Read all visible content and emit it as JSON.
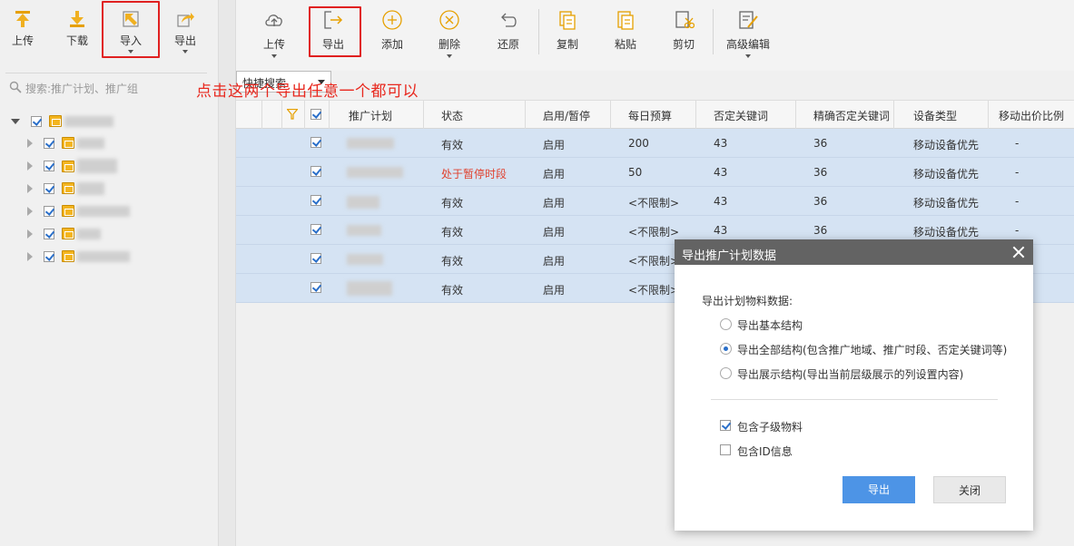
{
  "left_toolbar": {
    "items": [
      {
        "label": "上传",
        "icon": "upload-arrow-icon"
      },
      {
        "label": "下载",
        "icon": "download-arrow-icon"
      },
      {
        "label": "导入",
        "icon": "import-icon"
      },
      {
        "label": "导出",
        "icon": "export-icon"
      }
    ]
  },
  "left_search": {
    "placeholder": "搜索:推广计划、推广组"
  },
  "main_toolbar": {
    "items": [
      {
        "label": "上传",
        "icon": "cloud-upload-icon",
        "dropdown": true
      },
      {
        "label": "导出",
        "icon": "export-arrow-icon",
        "dropdown": false
      },
      {
        "label": "添加",
        "icon": "add-circle-icon",
        "dropdown": false
      },
      {
        "label": "删除",
        "icon": "delete-circle-icon",
        "dropdown": true
      },
      {
        "label": "还原",
        "icon": "undo-icon",
        "dropdown": false
      },
      {
        "label": "复制",
        "icon": "copy-icon",
        "dropdown": false
      },
      {
        "label": "粘贴",
        "icon": "paste-icon",
        "dropdown": false
      },
      {
        "label": "剪切",
        "icon": "cut-icon",
        "dropdown": false
      },
      {
        "label": "高级编辑",
        "icon": "advanced-edit-icon",
        "dropdown": true
      }
    ]
  },
  "quick_search": {
    "label": "快捷搜索"
  },
  "annotation": "点击这两个导出任意一个都可以",
  "table": {
    "headers": [
      "推广计划",
      "状态",
      "启用/暂停",
      "每日预算",
      "否定关键词",
      "精确否定关键词",
      "设备类型",
      "移动出价比例"
    ],
    "rows": [
      {
        "status": "有效",
        "enabled": "启用",
        "budget": "200",
        "neg_kw": "43",
        "exact_neg_kw": "36",
        "device": "移动设备优先",
        "mobile_bid": "-"
      },
      {
        "status": "处于暂停时段",
        "enabled": "启用",
        "budget": "50",
        "neg_kw": "43",
        "exact_neg_kw": "36",
        "device": "移动设备优先",
        "mobile_bid": "-"
      },
      {
        "status": "有效",
        "enabled": "启用",
        "budget": "<不限制>",
        "neg_kw": "43",
        "exact_neg_kw": "36",
        "device": "移动设备优先",
        "mobile_bid": "-"
      },
      {
        "status": "有效",
        "enabled": "启用",
        "budget": "<不限制>",
        "neg_kw": "43",
        "exact_neg_kw": "36",
        "device": "移动设备优先",
        "mobile_bid": "-"
      },
      {
        "status": "有效",
        "enabled": "启用",
        "budget": "<不限制>",
        "neg_kw": "",
        "exact_neg_kw": "",
        "device": "",
        "mobile_bid": ""
      },
      {
        "status": "有效",
        "enabled": "启用",
        "budget": "<不限制>",
        "neg_kw": "",
        "exact_neg_kw": "",
        "device": "",
        "mobile_bid": ""
      }
    ]
  },
  "dialog": {
    "title": "导出推广计划数据",
    "heading": "导出计划物料数据:",
    "options": [
      {
        "label": "导出基本结构",
        "selected": false
      },
      {
        "label": "导出全部结构(包含推广地域、推广时段、否定关键词等)",
        "selected": true
      },
      {
        "label": "导出展示结构(导出当前层级展示的列设置内容)",
        "selected": false
      }
    ],
    "checkboxes": [
      {
        "label": "包含子级物料",
        "checked": true
      },
      {
        "label": "包含ID信息",
        "checked": false
      }
    ],
    "export_button": "导出",
    "close_button": "关闭"
  },
  "colors": {
    "accent": "#4d94e6",
    "highlight_box": "#e02020",
    "annotation_text": "#e8281e",
    "selected_row": "#d5e3f3",
    "dialog_title_bg": "#636363",
    "paused_status": "#e0422f"
  }
}
